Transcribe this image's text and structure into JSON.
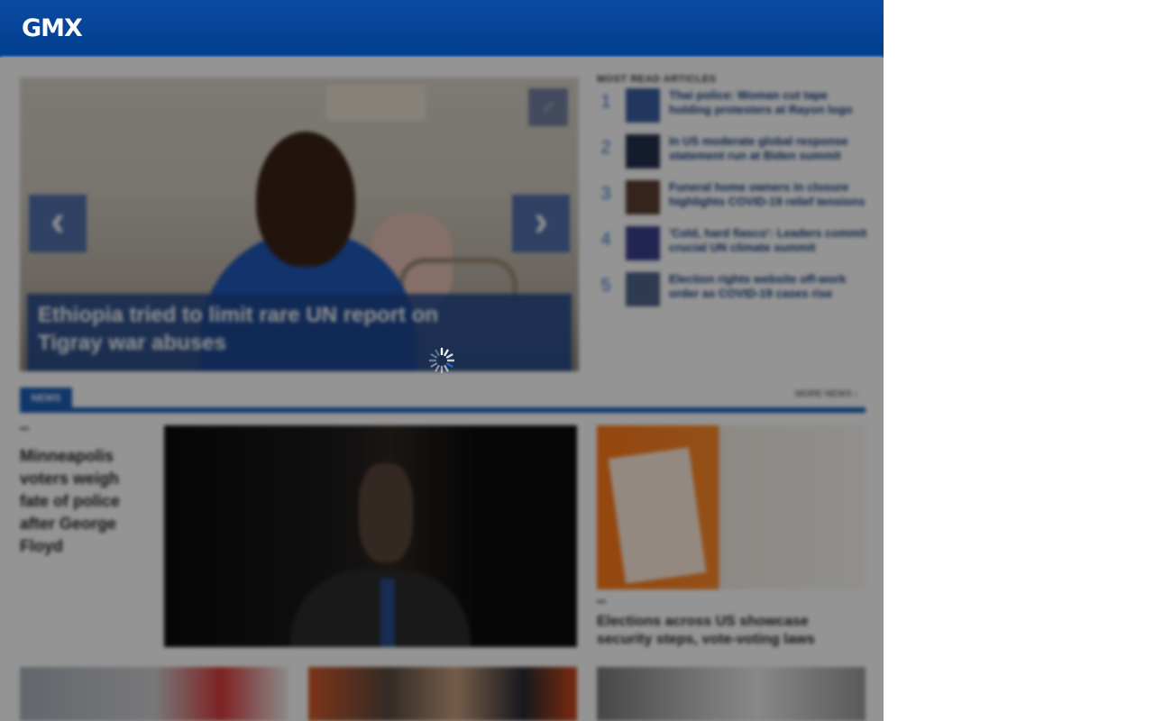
{
  "header": {
    "logo": "GMX"
  },
  "hero": {
    "expand_label": "⤢",
    "prev_arrow": "‹",
    "next_arrow": "›",
    "caption": "Ethiopia tried to limit rare UN report on Tigray war abuses"
  },
  "most_read": {
    "title": "MOST READ ARTICLES",
    "items": [
      {
        "rank": "1",
        "title": "Thai police: Woman cut tape holding protesters at Rayon logo",
        "thumb_color": "#3a5fa0"
      },
      {
        "rank": "2",
        "title": "In US moderate global response statement run at Biden summit",
        "thumb_color": "#24304e"
      },
      {
        "rank": "3",
        "title": "Funeral home owners in closure highlights COVID-19 relief tensions",
        "thumb_color": "#5a3e30"
      },
      {
        "rank": "4",
        "title": "'Cold, hard fiasco': Leaders commit crucial UN climate summit",
        "thumb_color": "#3b3f8e"
      },
      {
        "rank": "5",
        "title": "Election rights website off-work order as COVID-19 cases rise",
        "thumb_color": "#50658a"
      }
    ]
  },
  "section": {
    "tab_label": "NEWS",
    "more_label": "MORE NEWS ›",
    "lead": {
      "title": "Minneapolis voters weigh fate of police after George Floyd"
    },
    "side": {
      "title": "Elections across US showcase security steps, vote-voting laws"
    }
  }
}
